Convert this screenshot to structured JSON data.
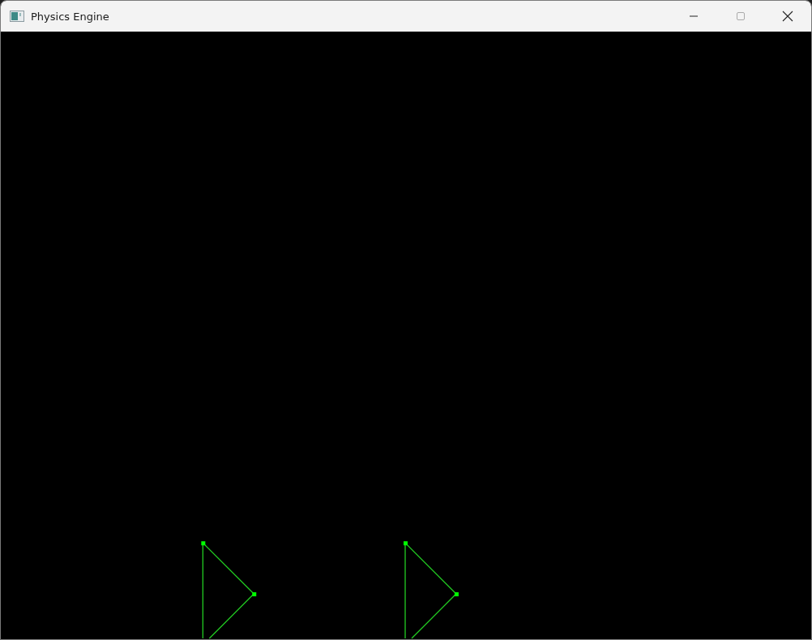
{
  "window": {
    "title": "Physics Engine"
  },
  "canvas": {
    "bodies": [
      {
        "kind": "triangle"
      },
      {
        "kind": "triangle"
      }
    ]
  }
}
